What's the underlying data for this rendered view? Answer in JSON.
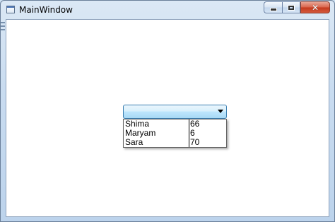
{
  "window": {
    "title": "MainWindow",
    "caption_buttons": {
      "minimize_icon": "minimize-icon",
      "maximize_icon": "maximize-icon",
      "close_icon": "close-icon",
      "close_glyph": "✕"
    },
    "frame_color": "#bcd3ec",
    "close_color": "#c4391c"
  },
  "combobox": {
    "selected_value": "",
    "selection_color": "#a7d9f5",
    "items": [
      {
        "name": "Shima",
        "value": "66"
      },
      {
        "name": "Maryam",
        "value": "6"
      },
      {
        "name": "Sara",
        "value": "70"
      }
    ]
  }
}
